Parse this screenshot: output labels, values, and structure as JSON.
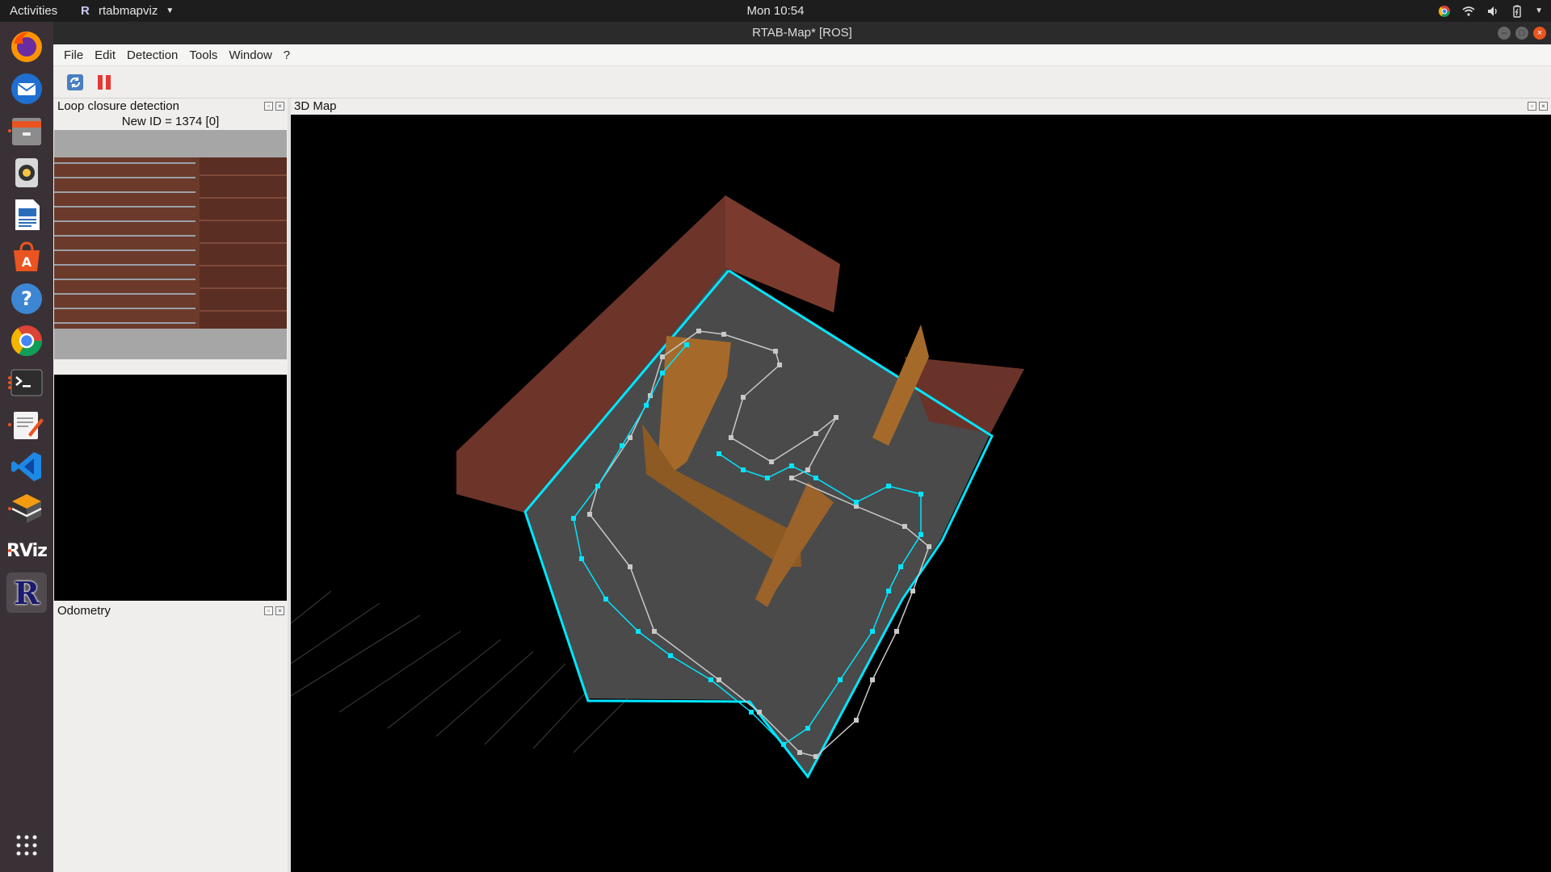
{
  "topbar": {
    "activities": "Activities",
    "app_menu": "rtabmapviz",
    "clock": "Mon 10:54"
  },
  "dock": {
    "apps": [
      {
        "name": "firefox-icon",
        "color": "#ff7b00"
      },
      {
        "name": "thunderbird-icon",
        "color": "#3a7bd5"
      },
      {
        "name": "files-icon",
        "color": "#9b9b9b"
      },
      {
        "name": "rhythmbox-icon",
        "color": "#f4c542"
      },
      {
        "name": "libreoffice-writer-icon",
        "color": "#2a6ebb"
      },
      {
        "name": "software-center-icon",
        "color": "#e95420"
      },
      {
        "name": "help-icon",
        "color": "#3d86d4"
      },
      {
        "name": "chrome-icon",
        "color": "#4caf50"
      },
      {
        "name": "terminal-icon",
        "color": "#2d2d2d"
      },
      {
        "name": "text-editor-icon",
        "color": "#f2f2f2"
      },
      {
        "name": "vscode-icon",
        "color": "#1e88e5"
      },
      {
        "name": "virtualbox-icon",
        "color": "#ef6c00"
      },
      {
        "name": "rviz-icon",
        "color": "#3a3136"
      },
      {
        "name": "rtabmap-icon",
        "color": "#1a1a6e"
      }
    ],
    "rviz_label": "RViz",
    "rtabmap_label": "R"
  },
  "window": {
    "title": "RTAB-Map* [ROS]",
    "menus": [
      "File",
      "Edit",
      "Detection",
      "Tools",
      "Window",
      "?"
    ],
    "toolbar": {
      "refresh_icon": "refresh-icon",
      "pause_icon": "pause-icon",
      "pause_color": "#e53935"
    }
  },
  "loop_closure": {
    "title": "Loop closure detection",
    "new_id": "New ID = 1374 [0]"
  },
  "odometry": {
    "title": "Odometry"
  },
  "map3d": {
    "title": "3D Map",
    "trajectory_color": "#00e5ff",
    "graph_color": "#c8c8c8",
    "wall_color": "#7a3b2e",
    "floor_color": "#4a4a4a"
  }
}
